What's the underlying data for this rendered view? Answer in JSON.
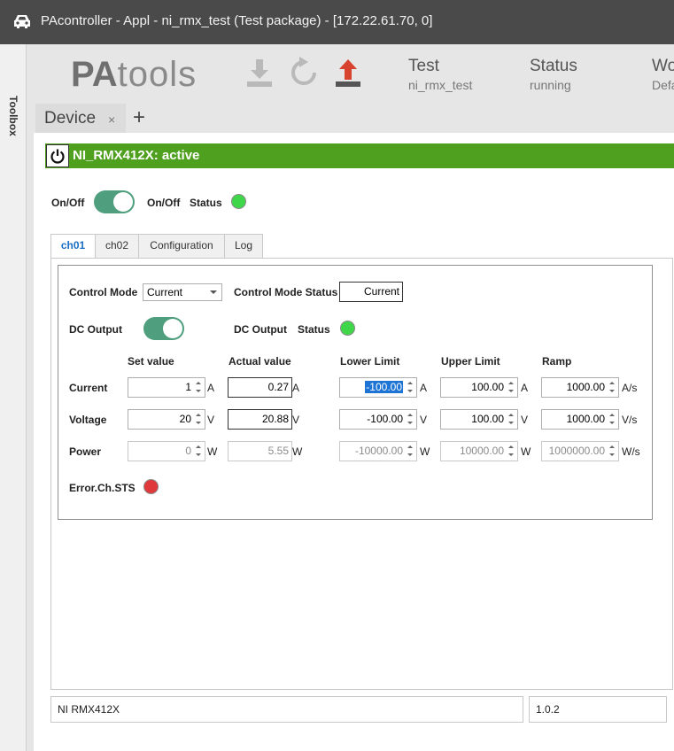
{
  "window": {
    "title": "PAcontroller - Appl - ni_rmx_test (Test package) - [172.22.61.70, 0]"
  },
  "toolbox": {
    "label": "Toolbox"
  },
  "header": {
    "logo_bold": "PA",
    "logo_light": "tools",
    "icons": [
      "download-icon",
      "refresh-icon",
      "upload-icon"
    ],
    "test_key": "Test",
    "test_val": "ni_rmx_test",
    "status_key": "Status",
    "status_val": "running",
    "wo_key": "Wo",
    "wo_val": "Defa"
  },
  "tabs": {
    "device_label": "Device",
    "close": "×",
    "add": "+"
  },
  "device": {
    "name_status": "NI_RMX412X: active",
    "onoff_label": "On/Off",
    "onoff_status_label": "On/Off",
    "status_label": "Status",
    "onoff_on": true,
    "status_color": "#3fd64a"
  },
  "subtabs": [
    "ch01",
    "ch02",
    "Configuration",
    "Log"
  ],
  "active_subtab": "ch01",
  "channel": {
    "control_mode_label": "Control Mode",
    "control_mode_value": "Current",
    "control_mode_status_label": "Control Mode Status",
    "control_mode_status_value": "Current",
    "dc_output_label": "DC Output",
    "dc_output_status_label": "DC Output",
    "status_label": "Status",
    "columns": {
      "set_value": "Set value",
      "actual_value": "Actual value",
      "lower_limit": "Lower Limit",
      "upper_limit": "Upper Limit",
      "ramp": "Ramp"
    },
    "rows": [
      {
        "label": "Current",
        "set": "1",
        "set_unit": "A",
        "actual": "0.27",
        "actual_unit": "A",
        "lower": "-100.00",
        "lower_unit": "A",
        "upper": "100.00",
        "upper_unit": "A",
        "ramp": "1000.00",
        "ramp_unit": "A/s"
      },
      {
        "label": "Voltage",
        "set": "20",
        "set_unit": "V",
        "actual": "20.88",
        "actual_unit": "V",
        "lower": "-100.00",
        "lower_unit": "V",
        "upper": "100.00",
        "upper_unit": "V",
        "ramp": "1000.00",
        "ramp_unit": "V/s"
      },
      {
        "label": "Power",
        "set": "0",
        "set_unit": "W",
        "actual": "5.55",
        "actual_unit": "W",
        "lower": "-10000.00",
        "lower_unit": "W",
        "upper": "10000.00",
        "upper_unit": "W",
        "ramp": "1000000.00",
        "ramp_unit": "W/s"
      }
    ],
    "error_label": "Error.Ch.STS"
  },
  "footer": {
    "device_model": "NI RMX412X",
    "version": "1.0.2"
  },
  "colors": {
    "active_green": "#4ea01e",
    "toggle_on": "#4f9e7d",
    "led_green": "#3fd64a",
    "led_red": "#e0393c",
    "upload_red": "#d8432f"
  }
}
